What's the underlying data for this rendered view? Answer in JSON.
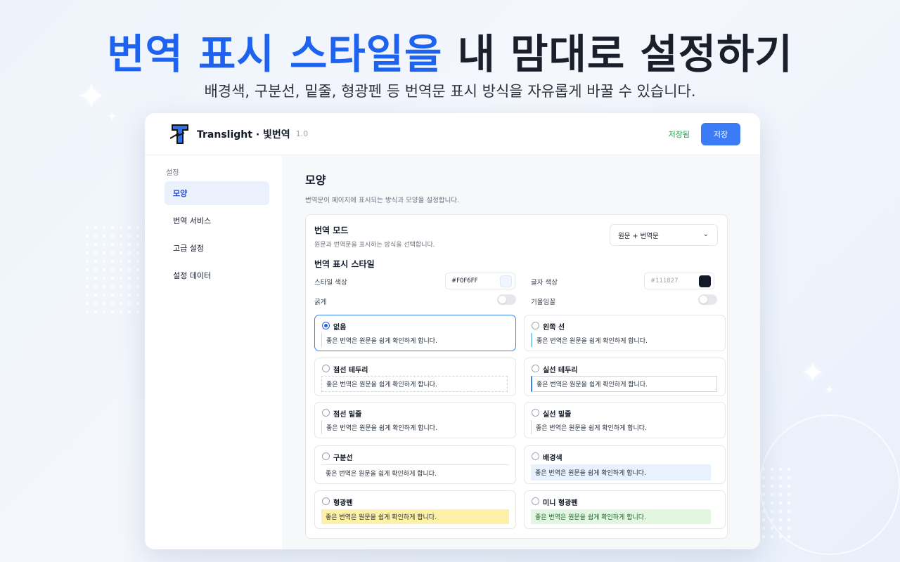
{
  "hero": {
    "title_accent": "번역 표시 스타일을",
    "title_rest": " 내 맘대로 설정하기",
    "subtitle": "배경색, 구분선, 밑줄, 형광펜 등 번역문 표시 방식을 자유롭게 바꿀 수 있습니다."
  },
  "app": {
    "name": "Translight · 빛번역",
    "version": "1.0",
    "saved_status": "저장됨",
    "save_label": "저장"
  },
  "sidebar": {
    "heading": "설정",
    "items": [
      {
        "label": "모양",
        "active": true
      },
      {
        "label": "번역 서비스",
        "active": false
      },
      {
        "label": "고급 설정",
        "active": false
      },
      {
        "label": "설정 데이터",
        "active": false
      }
    ]
  },
  "main": {
    "title": "모양",
    "description": "번역문이 페이지에 표시되는 방식과 모양을 설정합니다.",
    "mode": {
      "title": "번역 모드",
      "description": "원문과 번역문을 표시하는 방식을 선택합니다.",
      "selected": "원문 + 번역문"
    },
    "style": {
      "title": "번역 표시 스타일",
      "style_color_label": "스타일 색상",
      "style_color_value": "#F0F6FF",
      "style_color_hex": "#F0F6FF",
      "text_color_label": "글자 색상",
      "text_color_placeholder": "#111827",
      "text_color_hex": "#111827",
      "bold_label": "굵게",
      "bold_on": false,
      "italic_label": "기울임꼴",
      "italic_on": false
    },
    "sample_text": "좋은 번역은 원문을 쉽게 확인하게 합니다.",
    "options": [
      {
        "label": "없음",
        "selected": true
      },
      {
        "label": "왼쪽 선",
        "selected": false
      },
      {
        "label": "점선 테두리",
        "selected": false
      },
      {
        "label": "실선 테두리",
        "selected": false
      },
      {
        "label": "점선 밑줄",
        "selected": false
      },
      {
        "label": "실선 밑줄",
        "selected": false
      },
      {
        "label": "구분선",
        "selected": false
      },
      {
        "label": "배경색",
        "selected": false
      },
      {
        "label": "형광펜",
        "selected": false
      },
      {
        "label": "미니 형광펜",
        "selected": false
      }
    ]
  },
  "colors": {
    "accent": "#1e63f0",
    "button": "#3b7bf6",
    "saved": "#16a34a"
  }
}
